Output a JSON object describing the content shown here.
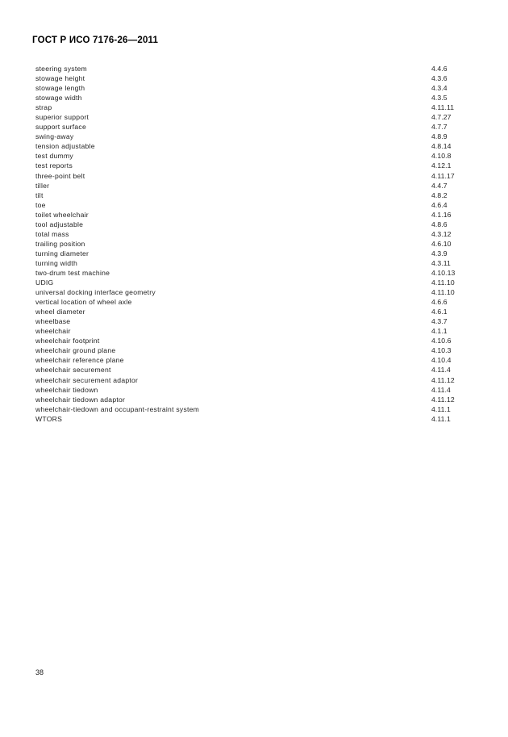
{
  "document": {
    "header": "ГОСТ Р ИСО 7176-26—2011",
    "page_number": "38"
  },
  "index": {
    "entries": [
      {
        "term": "steering system",
        "ref": "4.4.6"
      },
      {
        "term": "stowage height",
        "ref": "4.3.6"
      },
      {
        "term": "stowage length",
        "ref": "4.3.4"
      },
      {
        "term": "stowage width",
        "ref": "4.3.5"
      },
      {
        "term": "strap",
        "ref": "4.11.11"
      },
      {
        "term": "superior support",
        "ref": "4.7.27"
      },
      {
        "term": "support surface",
        "ref": "4.7.7"
      },
      {
        "term": "swing-away",
        "ref": "4.8.9"
      },
      {
        "term": "tension adjustable",
        "ref": "4.8.14"
      },
      {
        "term": "test dummy",
        "ref": "4.10.8"
      },
      {
        "term": "test reports",
        "ref": "4.12.1"
      },
      {
        "term": "three-point belt",
        "ref": "4.11.17"
      },
      {
        "term": "tiller",
        "ref": "4.4.7"
      },
      {
        "term": "tilt",
        "ref": "4.8.2"
      },
      {
        "term": "toe",
        "ref": "4.6.4"
      },
      {
        "term": "toilet wheelchair",
        "ref": "4.1.16"
      },
      {
        "term": "tool adjustable",
        "ref": "4.8.6"
      },
      {
        "term": "total mass",
        "ref": "4.3.12"
      },
      {
        "term": "trailing position",
        "ref": "4.6.10"
      },
      {
        "term": "turning diameter",
        "ref": "4.3.9"
      },
      {
        "term": "turning width",
        "ref": "4.3.11"
      },
      {
        "term": "two-drum test machine",
        "ref": "4.10.13"
      },
      {
        "term": "UDIG",
        "ref": "4.11.10"
      },
      {
        "term": "universal docking interface geometry",
        "ref": "4.11.10"
      },
      {
        "term": "vertical location of wheel axle",
        "ref": "4.6.6"
      },
      {
        "term": "wheel diameter",
        "ref": "4.6.1"
      },
      {
        "term": "wheelbase",
        "ref": "4.3.7"
      },
      {
        "term": "wheelchair",
        "ref": "4.1.1"
      },
      {
        "term": "wheelchair footprint",
        "ref": "4.10.6"
      },
      {
        "term": "wheelchair ground plane",
        "ref": "4.10.3"
      },
      {
        "term": "wheelchair reference plane",
        "ref": "4.10.4"
      },
      {
        "term": "wheelchair securement",
        "ref": "4.11.4"
      },
      {
        "term": "wheelchair securement adaptor",
        "ref": "4.11.12"
      },
      {
        "term": "wheelchair tiedown",
        "ref": "4.11.4"
      },
      {
        "term": "wheelchair tiedown adaptor",
        "ref": "4.11.12"
      },
      {
        "term": "wheelchair-tiedown and occupant-restraint system",
        "ref": "4.11.1"
      },
      {
        "term": "WTORS",
        "ref": "4.11.1"
      }
    ]
  }
}
